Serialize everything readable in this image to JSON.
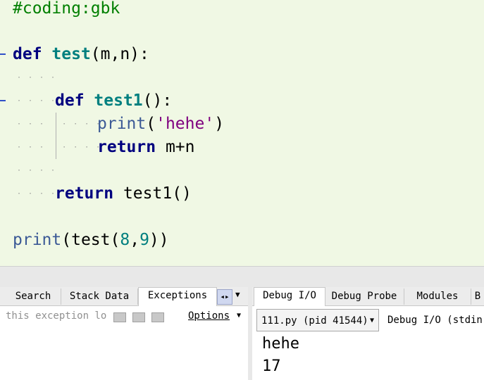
{
  "editor": {
    "line1": "#coding:gbk",
    "line2_kw": "def",
    "line2_fn": "test",
    "line2_rest": "(m,n):",
    "line4_kw": "def",
    "line4_fn": "test1",
    "line4_rest": "():",
    "line5_builtin": "print",
    "line5_open": "(",
    "line5_str": "'hehe'",
    "line5_close": ")",
    "line6_kw": "return",
    "line6_rest": "m+n",
    "line8_kw": "return",
    "line8_rest": "test1()",
    "line10_builtin": "print",
    "line10_a": "(test(",
    "line10_n1": "8",
    "line10_comma": ",",
    "line10_n2": "9",
    "line10_b": "))"
  },
  "left_pane": {
    "tabs": [
      "Search",
      "Stack Data",
      "Exceptions"
    ],
    "active_tab": "Exceptions",
    "placeholder": "this exception loc",
    "options_label": "Options"
  },
  "right_pane": {
    "tabs": [
      "Debug I/O",
      "Debug Probe",
      "Modules",
      "B"
    ],
    "active_tab": "Debug I/O",
    "process_select": "111.py (pid 41544)",
    "stream_label": "Debug I/O (stdin,",
    "output_lines": [
      "hehe",
      "17"
    ]
  },
  "icons": {
    "tab_scroll": "left-right-arrows-icon",
    "tab_menu": "chevron-down-icon"
  }
}
